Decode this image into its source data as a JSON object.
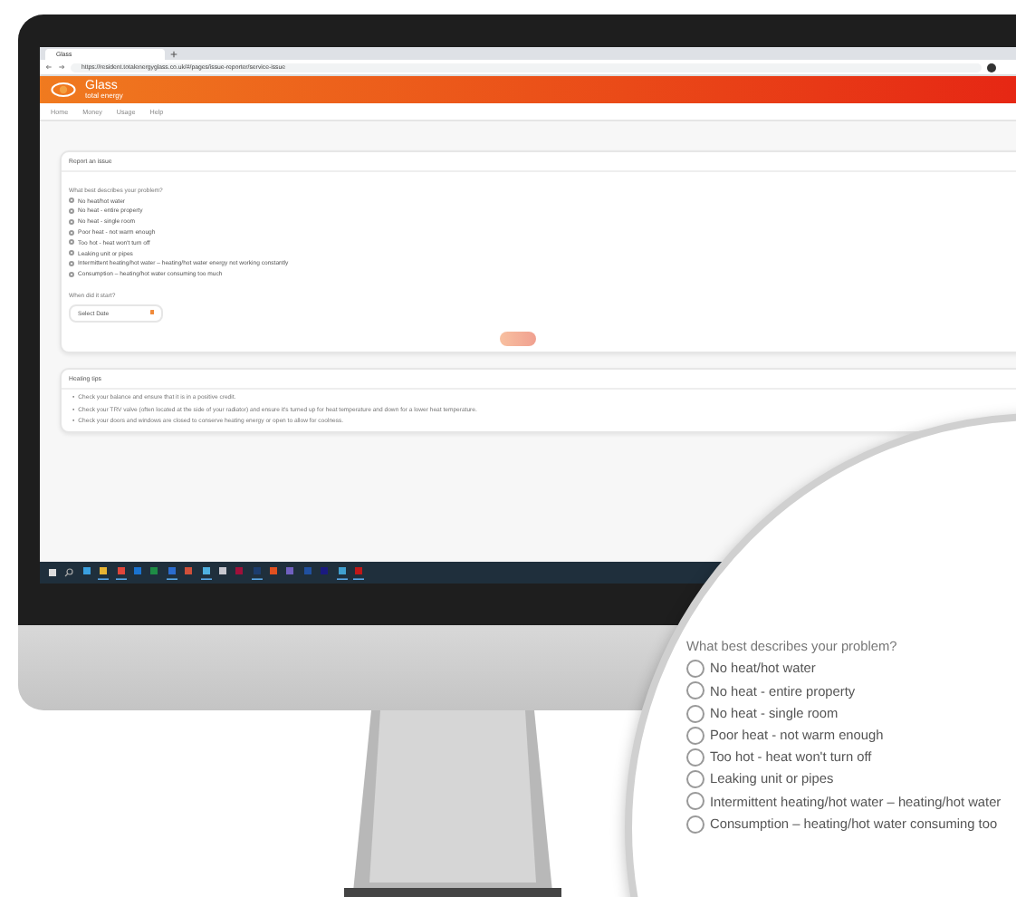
{
  "browser": {
    "tab_title": "Glass",
    "url": "https://resident.totalenergyglass.co.uk/#/pages/issue-reporter/service-issue"
  },
  "header": {
    "logo": "Glass",
    "logo_subtitle": "total energy"
  },
  "nav": [
    "Home",
    "Money",
    "Usage",
    "Help"
  ],
  "report": {
    "title": "Report an issue",
    "question": "What best describes your problem?",
    "options": [
      {
        "label": "No heat/hot water",
        "selected": false
      },
      {
        "label": "No heat - entire property",
        "selected": false
      },
      {
        "label": "No heat - single room",
        "selected": false
      },
      {
        "label": "Poor heat - not warm enough",
        "selected": false
      },
      {
        "label": "Too hot - heat won't turn off",
        "selected": false
      },
      {
        "label": "Leaking unit or pipes",
        "selected": false
      },
      {
        "label": "Intermittent heating/hot water – heating/hot water energy not working constantly",
        "selected": false
      },
      {
        "label": "Consumption – heating/hot water consuming too much",
        "selected": false
      }
    ],
    "date_label": "When did it start?",
    "date_placeholder": "Select Date"
  },
  "tips": {
    "title": "Heating tips",
    "marker": "•",
    "items": [
      "Check your balance and ensure that it is in a positive credit.",
      "Check your TRV valve (often located at the side of your radiator) and ensure it's turned up for heat temperature and down for a lower heat temperature.",
      "Check your doors and windows are closed to conserve heating energy or open to allow for coolness."
    ]
  },
  "taskbar": {
    "apps": [
      {
        "color": "#3aa0e0",
        "running": false
      },
      {
        "color": "#e8b432",
        "running": true
      },
      {
        "color": "#e0463a",
        "running": true
      },
      {
        "color": "#1a73d0",
        "running": false
      },
      {
        "color": "#1e8c45",
        "running": false
      },
      {
        "color": "#2b6ccf",
        "running": true
      },
      {
        "color": "#d0503a",
        "running": false
      },
      {
        "color": "#4fb0e0",
        "running": true
      },
      {
        "color": "#c8c8d0",
        "running": false
      },
      {
        "color": "#a0103a",
        "running": false
      },
      {
        "color": "#1c3d6e",
        "running": true
      },
      {
        "color": "#e05020",
        "running": false
      },
      {
        "color": "#7060c0",
        "running": false
      },
      {
        "color": "#2050a0",
        "running": false
      },
      {
        "color": "#1a1a80",
        "running": false
      },
      {
        "color": "#40a0d0",
        "running": true
      },
      {
        "color": "#c01818",
        "running": true
      }
    ]
  },
  "magnifier": {
    "question": "What best describes your problem?",
    "options": [
      {
        "label": "No heat/hot water",
        "selected": false
      },
      {
        "label": "No heat - entire property",
        "selected": false
      },
      {
        "label": "No heat - single room",
        "selected": false
      },
      {
        "label": "Poor heat - not warm enough",
        "selected": false
      },
      {
        "label": "Too hot - heat won't turn off",
        "selected": false
      },
      {
        "label": "Leaking unit or pipes",
        "selected": false
      },
      {
        "label": "Intermittent heating/hot water – heating/hot water",
        "selected": false
      },
      {
        "label": "Consumption – heating/hot water consuming too",
        "selected": false
      }
    ]
  }
}
